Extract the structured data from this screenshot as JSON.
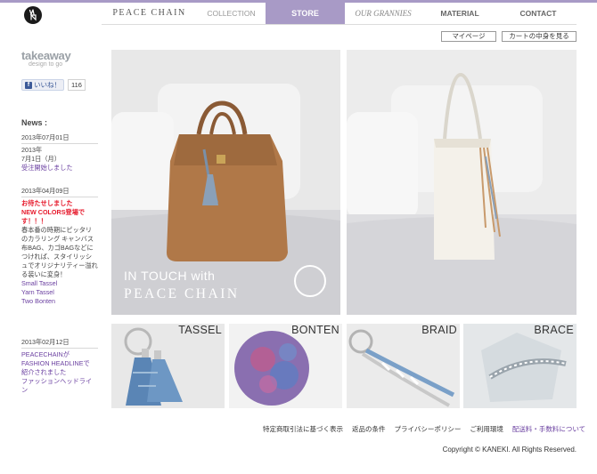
{
  "colors": {
    "accent": "#a89ac6",
    "link_purple": "#6a3fa0",
    "alert_red": "#e6192b"
  },
  "header": {
    "logo_icon": "peace-hand-icon",
    "nav": {
      "peace_chain": "PEACE CHAIN",
      "collection": "COLLECTION",
      "store": "STORE",
      "our_grannies": "OUR GRANNIES",
      "material": "MATERIAL",
      "contact": "CONTACT"
    },
    "util": {
      "mypage": "マイページ",
      "cart": "カートの中身を見る"
    }
  },
  "sidebar": {
    "brand_main": "takeaway",
    "brand_sub": "design to go",
    "like": {
      "label": "いいね！",
      "count": "116"
    },
    "news_title": "News :",
    "news": [
      {
        "date": "2013年07月01日",
        "lines": [
          "2013年",
          "7月1日（月）"
        ],
        "link": "受注開始しました"
      },
      {
        "date": "2013年04月09日",
        "red_lines": [
          "お待たせしました",
          "NEW COLORS登場で",
          "す！！！"
        ],
        "body": "春本番の時期にピッタリのカラリング キャンバス布BAG、カゴBAGなどにつければ、スタイリッシュでオリジナリティー溢れる装いに変身！",
        "links": [
          "Small Tassel",
          "Yarn Tassel",
          "Two Bonten"
        ]
      },
      {
        "date": "2013年02月12日",
        "link_lines": [
          "PEACECHAINが",
          "FASHION HEADLINEで",
          "紹介されました",
          "ファッションヘッドライン"
        ]
      }
    ]
  },
  "hero": {
    "caption_line1": "IN TOUCH with",
    "caption_line2": "PEACE CHAIN"
  },
  "thumbs": {
    "tassel": "TASSEL",
    "bonten": "BONTEN",
    "braid": "BRAID",
    "brace": "BRACE"
  },
  "footer": {
    "links": [
      "特定商取引法に基づく表示",
      "返品の条件",
      "プライバシーポリシー",
      "ご利用環境",
      "配送料・手数料について"
    ],
    "copyright": "Copyright © KANEKI. All Rights Reserved."
  }
}
